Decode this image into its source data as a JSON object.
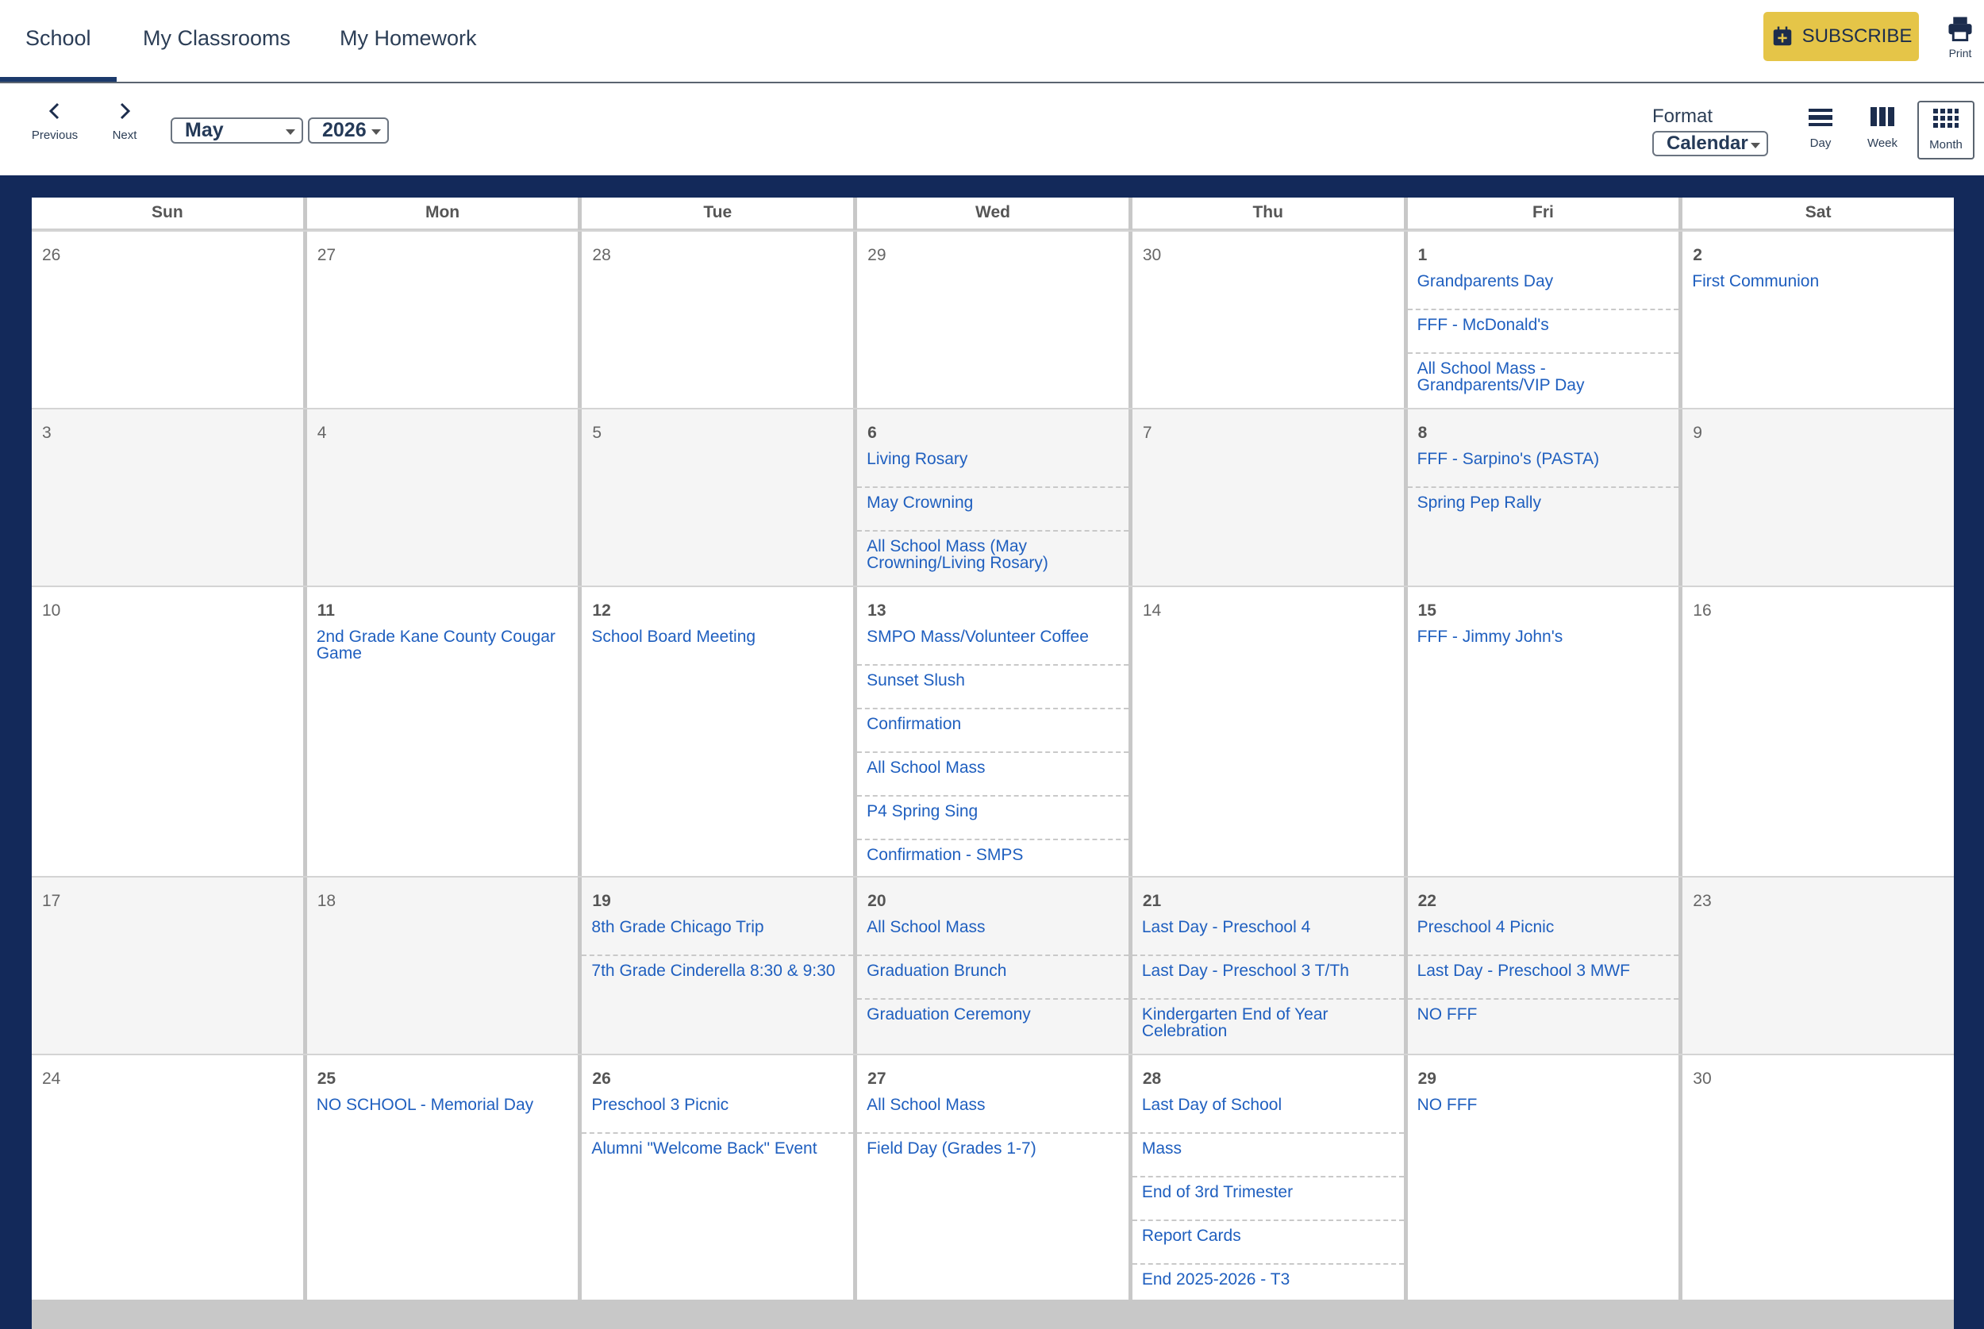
{
  "tabs": [
    {
      "label": "School",
      "active": true
    },
    {
      "label": "My Classrooms",
      "active": false
    },
    {
      "label": "My Homework",
      "active": false
    }
  ],
  "toolbar": {
    "subscribe_label": "SUBSCRIBE",
    "subscribe_icon": "calendar-plus-icon",
    "print_label": "Print",
    "print_icon": "printer-icon"
  },
  "nav": {
    "previous_label": "Previous",
    "next_label": "Next",
    "month": "May",
    "year": "2026",
    "format_label": "Format",
    "format_value": "Calendar",
    "views": [
      {
        "label": "Day",
        "icon": "day-view-icon",
        "active": false
      },
      {
        "label": "Week",
        "icon": "week-view-icon",
        "active": false
      },
      {
        "label": "Month",
        "icon": "month-view-icon",
        "active": true
      }
    ]
  },
  "colors": {
    "accent": "#e5c548",
    "frame": "#13295a",
    "event_link": "#1f5fbf"
  },
  "calendar": {
    "weekdays": [
      "Sun",
      "Mon",
      "Tue",
      "Wed",
      "Thu",
      "Fri",
      "Sat"
    ],
    "weeks": [
      {
        "days": [
          {
            "day": "26",
            "events": []
          },
          {
            "day": "27",
            "events": []
          },
          {
            "day": "28",
            "events": []
          },
          {
            "day": "29",
            "events": []
          },
          {
            "day": "30",
            "events": []
          },
          {
            "day": "1",
            "events": [
              "Grandparents Day",
              "FFF - McDonald's",
              "All School Mass - Grandparents/VIP Day"
            ]
          },
          {
            "day": "2",
            "events": [
              "First Communion"
            ]
          }
        ]
      },
      {
        "days": [
          {
            "day": "3",
            "events": []
          },
          {
            "day": "4",
            "events": []
          },
          {
            "day": "5",
            "events": []
          },
          {
            "day": "6",
            "events": [
              "Living Rosary",
              "May Crowning",
              "All School Mass (May Crowning/Living Rosary)"
            ]
          },
          {
            "day": "7",
            "events": []
          },
          {
            "day": "8",
            "events": [
              "FFF - Sarpino's (PASTA)",
              "Spring Pep Rally"
            ]
          },
          {
            "day": "9",
            "events": []
          }
        ]
      },
      {
        "days": [
          {
            "day": "10",
            "events": []
          },
          {
            "day": "11",
            "events": [
              "2nd Grade Kane County Cougar Game"
            ]
          },
          {
            "day": "12",
            "events": [
              "School Board Meeting"
            ]
          },
          {
            "day": "13",
            "events": [
              "SMPO Mass/Volunteer Coffee",
              "Sunset Slush",
              "Confirmation",
              "All School Mass",
              "P4 Spring Sing",
              "Confirmation - SMPS"
            ]
          },
          {
            "day": "14",
            "events": []
          },
          {
            "day": "15",
            "events": [
              "FFF - Jimmy John's"
            ]
          },
          {
            "day": "16",
            "events": []
          }
        ]
      },
      {
        "days": [
          {
            "day": "17",
            "events": []
          },
          {
            "day": "18",
            "events": []
          },
          {
            "day": "19",
            "events": [
              "8th Grade Chicago Trip",
              "7th Grade Cinderella 8:30 & 9:30"
            ]
          },
          {
            "day": "20",
            "events": [
              "All School Mass",
              "Graduation Brunch",
              "Graduation Ceremony"
            ]
          },
          {
            "day": "21",
            "events": [
              "Last Day - Preschool 4",
              "Last Day - Preschool 3 T/Th",
              "Kindergarten End of Year Celebration"
            ]
          },
          {
            "day": "22",
            "events": [
              "Preschool 4 Picnic",
              "Last Day - Preschool 3 MWF",
              "NO FFF"
            ]
          },
          {
            "day": "23",
            "events": []
          }
        ]
      },
      {
        "days": [
          {
            "day": "24",
            "events": []
          },
          {
            "day": "25",
            "events": [
              "NO SCHOOL - Memorial Day"
            ]
          },
          {
            "day": "26",
            "events": [
              "Preschool 3 Picnic",
              "Alumni \"Welcome Back\" Event"
            ]
          },
          {
            "day": "27",
            "events": [
              "All School Mass",
              "Field Day (Grades 1-7)"
            ]
          },
          {
            "day": "28",
            "events": [
              "Last Day of School",
              "Mass",
              "End of 3rd Trimester",
              "Report Cards",
              "End 2025-2026 - T3"
            ]
          },
          {
            "day": "29",
            "events": [
              "NO FFF"
            ]
          },
          {
            "day": "30",
            "events": []
          }
        ]
      }
    ]
  }
}
